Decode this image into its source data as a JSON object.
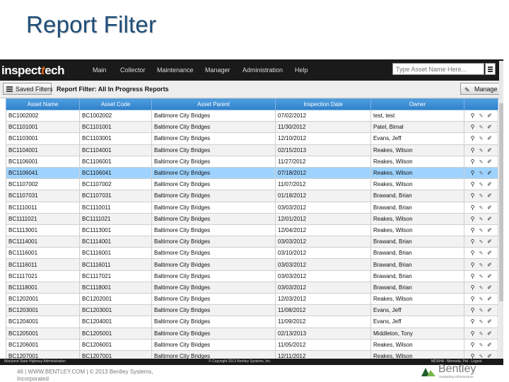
{
  "slide": {
    "title": "Report Filter",
    "footer_text": "46 | WWW.BENTLEY.COM | © 2013 Bentley Systems,",
    "footer_text2": "Incorporated",
    "bentley_logo": {
      "name": "Bentley",
      "tagline": "Sustaining Infrastructure"
    }
  },
  "app": {
    "logo": {
      "part1": "inspect",
      "part2": "t",
      "part3": "ech"
    },
    "nav": [
      "Main",
      "Collector",
      "Maintenance",
      "Manager",
      "Administration",
      "Help"
    ],
    "search": {
      "placeholder": "Type Asset Name Here..."
    },
    "toolbar": {
      "saved_filters_label": "Saved Filters",
      "filter_title": "Report Filter: All In Progress Reports",
      "manage_label": "Manage"
    },
    "table": {
      "columns": [
        "Asset Name",
        "Asset Code",
        "Asset Parent",
        "Inspection Date",
        "Owner"
      ],
      "selected_row": 5,
      "rows": [
        [
          "BC1002002",
          "BC1002002",
          "Baltimore City Bridges",
          "07/02/2012",
          "test, test"
        ],
        [
          "BC1101001",
          "BC1101001",
          "Baltimore City Bridges",
          "11/30/2012",
          "Patel, Bimal"
        ],
        [
          "BC1103001",
          "BC1103001",
          "Baltimore City Bridges",
          "12/10/2012",
          "Evans, Jeff"
        ],
        [
          "BC1104001",
          "BC1104001",
          "Baltimore City Bridges",
          "02/15/2013",
          "Reakes, Wilson"
        ],
        [
          "BC1106001",
          "BC1106001",
          "Baltimore City Bridges",
          "11/27/2012",
          "Reakes, Wilson"
        ],
        [
          "BC1106041",
          "BC1106041",
          "Baltimore City Bridges",
          "07/18/2012",
          "Reakes, Wilson"
        ],
        [
          "BC1107002",
          "BC1107002",
          "Baltimore City Bridges",
          "11/07/2012",
          "Reakes, Wilson"
        ],
        [
          "BC1107031",
          "BC1107031",
          "Baltimore City Bridges",
          "01/18/2012",
          "Brawand, Brian"
        ],
        [
          "BC1110011",
          "BC1110011",
          "Baltimore City Bridges",
          "03/03/2012",
          "Brawand, Brian"
        ],
        [
          "BC1111021",
          "BC1111021",
          "Baltimore City Bridges",
          "12/01/2012",
          "Reakes, Wilson"
        ],
        [
          "BC1113001",
          "BC1113001",
          "Baltimore City Bridges",
          "12/04/2012",
          "Reakes, Wilson"
        ],
        [
          "BC1114001",
          "BC1114001",
          "Baltimore City Bridges",
          "03/03/2012",
          "Brawand, Brian"
        ],
        [
          "BC1116001",
          "BC1116001",
          "Baltimore City Bridges",
          "03/10/2012",
          "Brawand, Brian"
        ],
        [
          "BC1116011",
          "BC1116011",
          "Baltimore City Bridges",
          "03/03/2012",
          "Brawand, Brian"
        ],
        [
          "BC1117021",
          "BC1117021",
          "Baltimore City Bridges",
          "03/03/2012",
          "Brawand, Brian"
        ],
        [
          "BC1118001",
          "BC1118001",
          "Baltimore City Bridges",
          "03/03/2012",
          "Brawand, Brian"
        ],
        [
          "BC1202001",
          "BC1202001",
          "Baltimore City Bridges",
          "12/03/2012",
          "Reakes, Wilson"
        ],
        [
          "BC1203001",
          "BC1203001",
          "Baltimore City Bridges",
          "11/08/2012",
          "Evans, Jeff"
        ],
        [
          "BC1204001",
          "BC1204001",
          "Baltimore City Bridges",
          "11/09/2012",
          "Evans, Jeff"
        ],
        [
          "BC1205001",
          "BC1205001",
          "Baltimore City Bridges",
          "02/13/2013",
          "Middleton, Tony"
        ],
        [
          "BC1206001",
          "BC1206001",
          "Baltimore City Bridges",
          "11/05/2012",
          "Reakes, Wilson"
        ],
        [
          "BC1207001",
          "BC1207001",
          "Baltimore City Bridges",
          "12/11/2012",
          "Reakes, Wilson"
        ]
      ]
    },
    "footer": {
      "left": "Maryland State Highway Administration",
      "center": "© Copyright 2013 Bentley Systems, Inc.",
      "right": "MDSHA - Memeda, Pat - Logout"
    }
  },
  "colors": {
    "title": "#1f4e79",
    "header": "#3a8bd6",
    "selected_row": "#9fd3ff",
    "navbar": "#1a1a1a",
    "logo_accent": "#e26b1a"
  }
}
